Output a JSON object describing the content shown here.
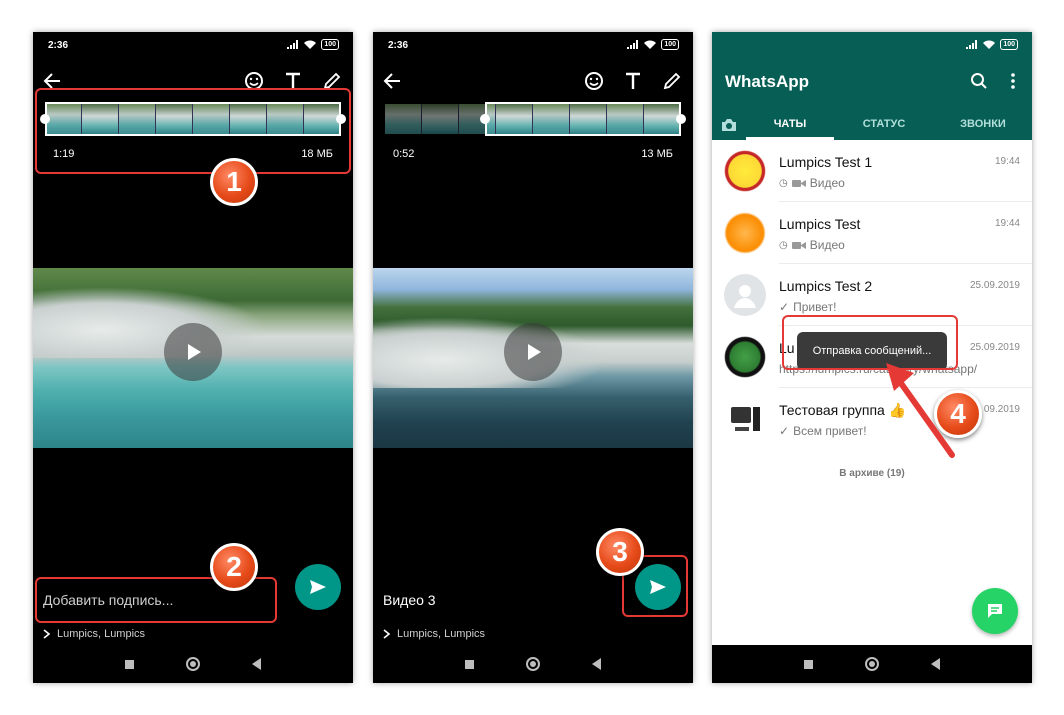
{
  "screens": [
    {
      "status_time": "2:36",
      "battery": "100",
      "trim_duration": "1:19",
      "trim_size": "18 МБ",
      "caption_placeholder": "Добавить подпись...",
      "recipients": "Lumpics, Lumpics",
      "step_badge": "1",
      "step_badge2": "2"
    },
    {
      "status_time": "2:36",
      "battery": "100",
      "trim_duration": "0:52",
      "trim_size": "13 МБ",
      "caption_value": "Видео 3",
      "recipients": "Lumpics, Lumpics",
      "step_badge": "3"
    },
    {
      "battery": "100",
      "app_title": "WhatsApp",
      "tabs": [
        "ЧАТЫ",
        "СТАТУС",
        "ЗВОНКИ"
      ],
      "chats": [
        {
          "name": "Lumpics Test 1",
          "message": "Видео",
          "time": "19:44"
        },
        {
          "name": "Lumpics Test",
          "message": "Видео",
          "time": "19:44"
        },
        {
          "name": "Lumpics Test 2",
          "message": "Привет!",
          "time": "25.09.2019"
        },
        {
          "name": "Lu",
          "message": "https://lumpics.ru/category/whatsapp/",
          "time": "25.09.2019"
        },
        {
          "name": "Тестовая группа 👍",
          "message": "Всем привет!",
          "time": "09.2019"
        }
      ],
      "archive": "В архиве (19)",
      "toast": "Отправка сообщений...",
      "step_badge": "4"
    }
  ],
  "colors": {
    "whatsapp_green": "#075e54",
    "send_teal": "#009688",
    "fab_green": "#25d366",
    "highlight_red": "#e53935"
  }
}
